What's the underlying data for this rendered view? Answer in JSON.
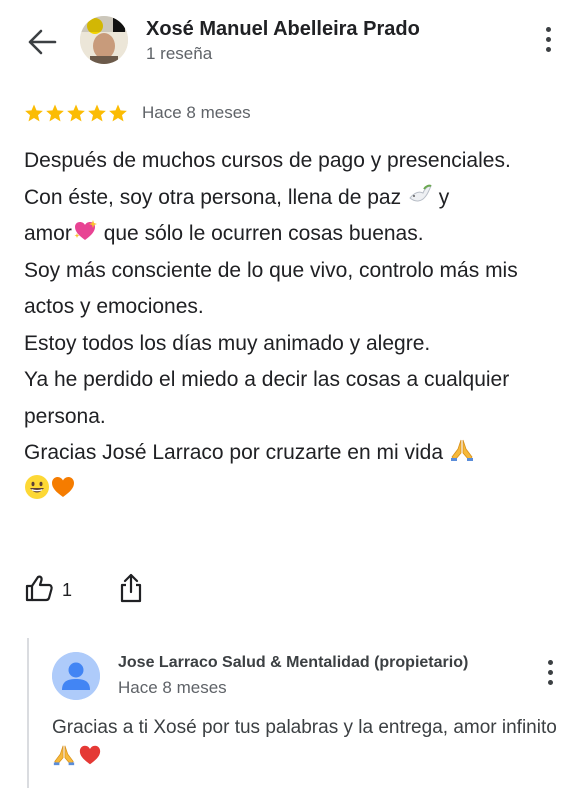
{
  "header": {
    "back_icon": "arrow-back-icon",
    "author_name": "Xosé Manuel Abelleira Prado",
    "author_meta": "1 reseña",
    "menu_icon": "more-vert-icon"
  },
  "rating": {
    "stars": 5,
    "max_stars": 5,
    "star_color": "#fbbc04",
    "time": "Hace 8 meses"
  },
  "review": {
    "lines": [
      "Después de muchos cursos de pago y presenciales.",
      "Con éste, soy otra persona, llena de paz",
      "y",
      "amor",
      "que sólo le ocurren cosas buenas.",
      "Soy más consciente de lo que vivo, controlo más mis actos y emociones.",
      "Estoy todos los días muy animado y alegre.",
      "Ya he perdido el miedo a decir las cosas a cualquier persona.",
      "Gracias José Larraco por cruzarte en mi vida"
    ],
    "emojis": [
      "dove-emoji",
      "sparkling-heart-emoji",
      "folded-hands-emoji",
      "grinning-face-emoji",
      "orange-heart-emoji"
    ]
  },
  "actions": {
    "like_icon": "thumbs-up-icon",
    "like_count": "1",
    "share_icon": "share-icon"
  },
  "reply": {
    "owner": "Jose Larraco Salud & Mentalidad (propietario)",
    "time": "Hace 8 meses",
    "text": "Gracias a ti Xosé por tus palabras y la entrega, amor infinito",
    "emojis": [
      "folded-hands-emoji",
      "red-heart-emoji"
    ],
    "avatar_color": "#aecbfa",
    "avatar_figure_color": "#4285f4",
    "menu_icon": "more-vert-icon"
  }
}
